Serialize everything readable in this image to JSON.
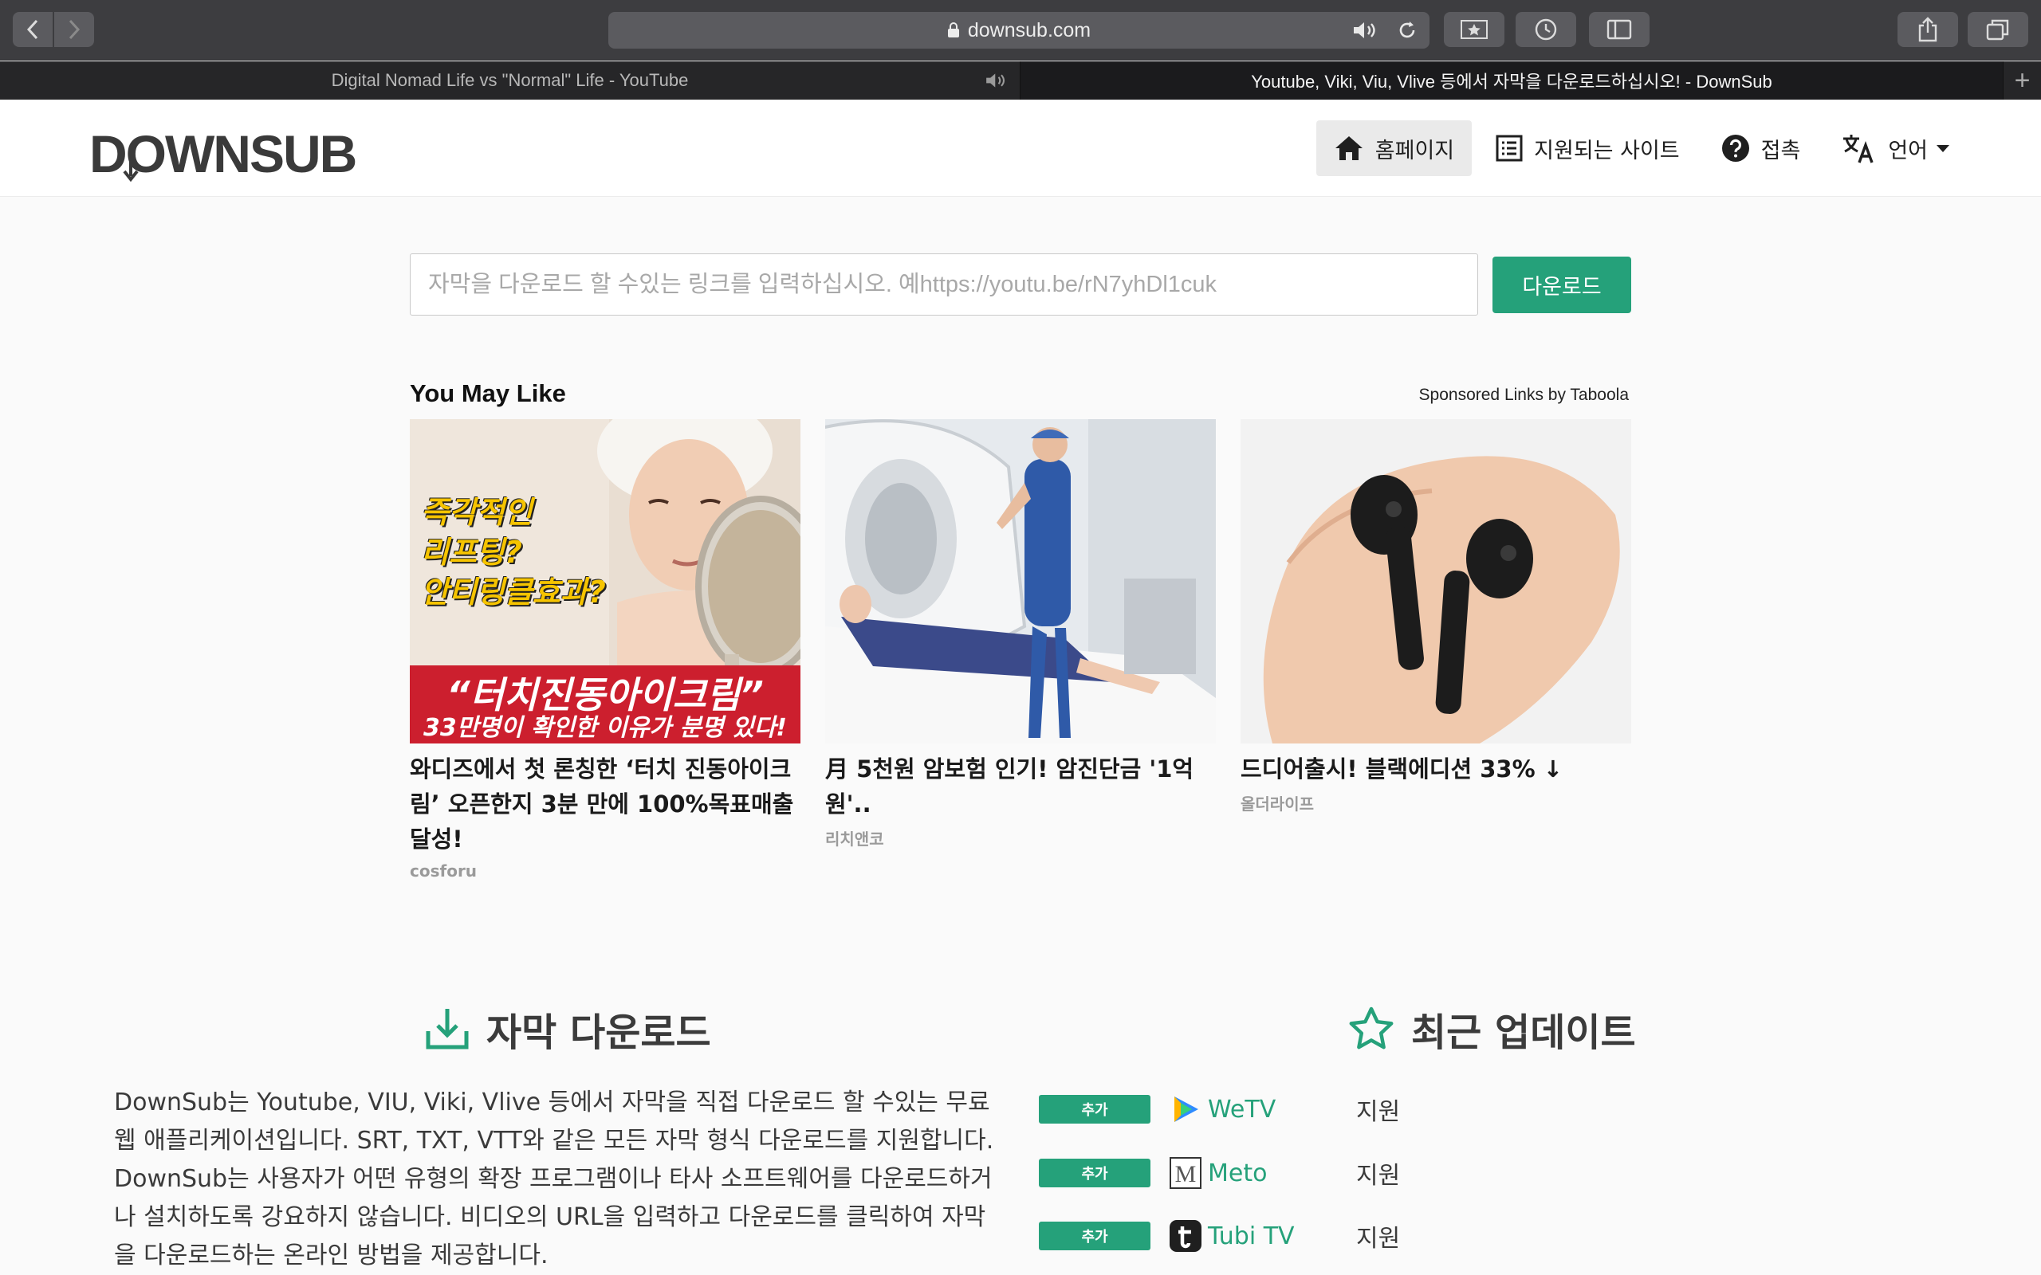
{
  "browser": {
    "url": "downsub.com",
    "tabs": [
      {
        "title": "Digital Nomad Life vs \"Normal\" Life - YouTube",
        "active": false,
        "audio": true
      },
      {
        "title": "Youtube, Viki, Viu, Vlive 등에서 자막을 다운로드하십시오! - DownSub",
        "active": true,
        "audio": false
      }
    ],
    "new_tab": "+"
  },
  "site": {
    "logo_text": "DOWNSUB",
    "menu": [
      {
        "label": "홈페이지",
        "icon": "home-icon",
        "active": true
      },
      {
        "label": "지원되는 사이트",
        "icon": "list-icon",
        "active": false
      },
      {
        "label": "접촉",
        "icon": "help-circle-icon",
        "active": false
      },
      {
        "label": "언어",
        "icon": "translate-icon",
        "active": false
      }
    ]
  },
  "search": {
    "placeholder": "자막을 다운로드 할 수있는 링크를 입력하십시오. 예https://youtu.be/rN7yhDl1cuk",
    "value": "",
    "button_label": "다운로드"
  },
  "feed": {
    "title": "You May Like",
    "sponsor": "Sponsored Links by Taboola",
    "cards": [
      {
        "headline": "와디즈에서 첫 론칭한 ‘터치 진동아이크림’ 오픈한지 3분 만에 100%목표매출 달성!",
        "brand": "cosforu",
        "thumb_text": [
          "즉각적인",
          "리프팅?",
          "안티링클효과?"
        ],
        "thumb_banner": "“터치진동아이크림”",
        "thumb_banner_sub": "33만명이 확인한 이유가 분명 있다!"
      },
      {
        "headline": "月 5천원 암보험 인기! 암진단금 '1억원'..",
        "brand": "리치앤코"
      },
      {
        "headline": "드디어출시! 블랙에디션 33% ↓",
        "brand": "올더라이프"
      }
    ]
  },
  "sections": {
    "download_title": "자막 다운로드",
    "updates_title": "최근 업데이트",
    "description": "DownSub는 Youtube, VIU, Viki, Vlive 등에서 자막을 직접 다운로드 할 수있는 무료 웹 애플리케이션입니다. SRT, TXT, VTT와 같은 모든 자막 형식 다운로드를 지원합니다. DownSub는 사용자가 어떤 유형의 확장 프로그램이나 타사 소프트웨어를 다운로드하거나 설치하도록 강요하지 않습니다. 비디오의 URL을 입력하고 다운로드를 클릭하여 자막을 다운로드하는 온라인 방법을 제공합니다.",
    "updates": [
      {
        "badge": "추가",
        "site": "WeTV",
        "status": "지원",
        "icon": "wetv-icon"
      },
      {
        "badge": "추가",
        "site": "Meto",
        "status": "지원",
        "icon": "meto-icon"
      },
      {
        "badge": "추가",
        "site": "Tubi TV",
        "status": "지원",
        "icon": "tubi-icon"
      }
    ]
  },
  "colors": {
    "accent": "#25a17a",
    "banner_red": "#cc1f2e",
    "toolbar": "#3d3d40"
  }
}
